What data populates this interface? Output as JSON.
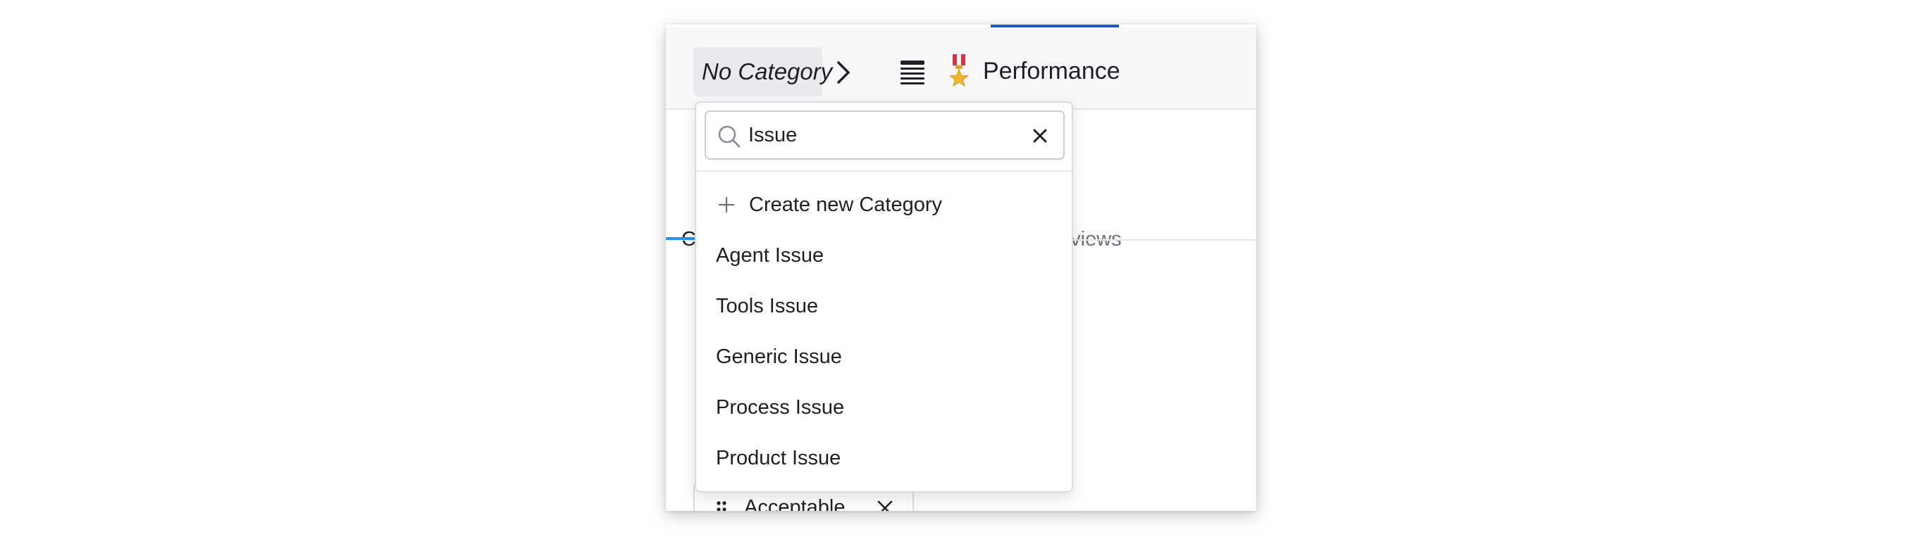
{
  "breadcrumb": {
    "category_label": "No Category",
    "document_title": "Performance"
  },
  "tabs": {
    "first_label_partial": "C",
    "reviews_label_partial": "eviews"
  },
  "chip": {
    "label": "Acceptable"
  },
  "dropdown": {
    "search": {
      "value": "Issue",
      "placeholder": ""
    },
    "create_label": "Create new Category",
    "options": [
      "Agent Issue",
      "Tools Issue",
      "Generic Issue",
      "Process Issue",
      "Product Issue"
    ]
  },
  "colors": {
    "accent_blue": "#2196f3",
    "top_indicator": "#1e5bb8",
    "pill_background": "#e8eaed",
    "header_background": "#f7f8fa",
    "text_primary": "#1e1f23",
    "text_muted": "#6b6f76"
  },
  "icons": {
    "breadcrumb_separator": "chevron-right-icon",
    "document_type": "list-icon",
    "document_emoji": "medal-icon",
    "search": "search-icon",
    "clear": "close-icon",
    "create": "plus-icon",
    "drag": "drag-handle-icon",
    "chip_remove": "close-icon"
  }
}
